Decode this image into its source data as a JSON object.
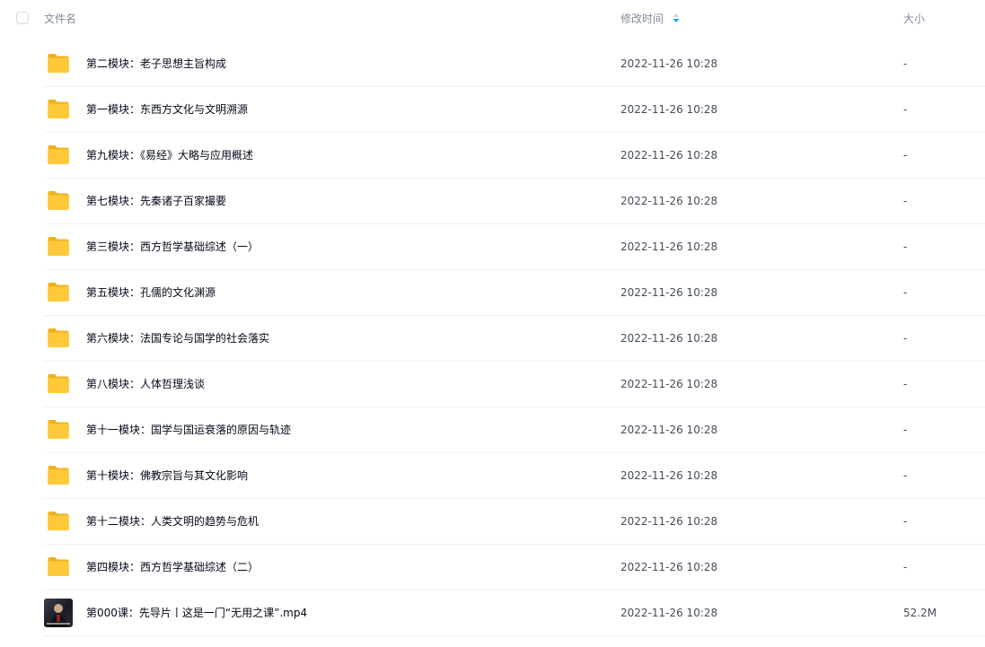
{
  "header": {
    "name_label": "文件名",
    "time_label": "修改时间",
    "size_label": "大小"
  },
  "colors": {
    "folder": "#ffc93a",
    "sort_active": "#06a7ff",
    "sort_inactive": "#c4d7f2"
  },
  "files": [
    {
      "type": "folder",
      "icon": "folder-icon",
      "name": "第二模块：老子思想主旨构成",
      "time": "2022-11-26 10:28",
      "size": "-"
    },
    {
      "type": "folder",
      "icon": "folder-icon",
      "name": "第一模块：东西方文化与文明溯源",
      "time": "2022-11-26 10:28",
      "size": "-"
    },
    {
      "type": "folder",
      "icon": "folder-icon",
      "name": "第九模块：《易经》大略与应用概述",
      "time": "2022-11-26 10:28",
      "size": "-"
    },
    {
      "type": "folder",
      "icon": "folder-icon",
      "name": "第七模块：先秦诸子百家撮要",
      "time": "2022-11-26 10:28",
      "size": "-"
    },
    {
      "type": "folder",
      "icon": "folder-icon",
      "name": "第三模块：西方哲学基础综述（一）",
      "time": "2022-11-26 10:28",
      "size": "-"
    },
    {
      "type": "folder",
      "icon": "folder-icon",
      "name": "第五模块：孔儒的文化渊源",
      "time": "2022-11-26 10:28",
      "size": "-"
    },
    {
      "type": "folder",
      "icon": "folder-icon",
      "name": "第六模块：法国专论与国学的社会落实",
      "time": "2022-11-26 10:28",
      "size": "-"
    },
    {
      "type": "folder",
      "icon": "folder-icon",
      "name": "第八模块：人体哲理浅谈",
      "time": "2022-11-26 10:28",
      "size": "-"
    },
    {
      "type": "folder",
      "icon": "folder-icon",
      "name": "第十一模块：国学与国运衰落的原因与轨迹",
      "time": "2022-11-26 10:28",
      "size": "-"
    },
    {
      "type": "folder",
      "icon": "folder-icon",
      "name": "第十模块：佛教宗旨与其文化影响",
      "time": "2022-11-26 10:28",
      "size": "-"
    },
    {
      "type": "folder",
      "icon": "folder-icon",
      "name": "第十二模块：人类文明的趋势与危机",
      "time": "2022-11-26 10:28",
      "size": "-"
    },
    {
      "type": "folder",
      "icon": "folder-icon",
      "name": "第四模块：西方哲学基础综述（二）",
      "time": "2022-11-26 10:28",
      "size": "-"
    },
    {
      "type": "video",
      "icon": "video-thumbnail",
      "name": "第000课：先导片丨这是一门“无用之课”.mp4",
      "time": "2022-11-26 10:28",
      "size": "52.2M"
    }
  ]
}
